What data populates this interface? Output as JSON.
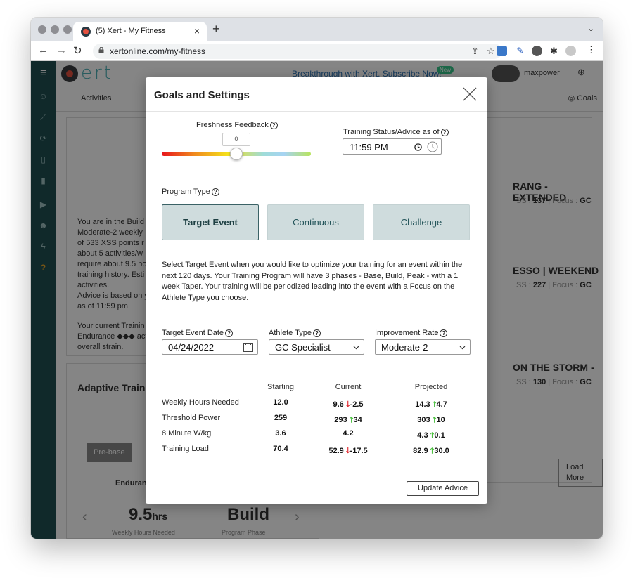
{
  "browser": {
    "tab_title": "(5) Xert - My Fitness",
    "url": "xertonline.com/my-fitness"
  },
  "app": {
    "logo": "ert",
    "promo": "Breakthrough with Xert. Subscribe Now!",
    "new_badge": "New",
    "notif_count": "5",
    "username": "maxpower",
    "subnav_activities": "Activities",
    "subnav_goals": "Goals"
  },
  "background": {
    "status_lines": [
      "You are in the Build",
      "Moderate-2 weekly",
      "of 533 XSS points r",
      "about 5 activities/w",
      "require about 9.5 ho",
      "training history. Esti",
      "activities.",
      "Advice is based on y",
      "as of 11:59 pm"
    ],
    "current_lines": [
      "Your current Trainin",
      "Endurance ◆◆◆ act",
      "overall strain."
    ],
    "adaptive_title": "Adaptive Traini",
    "pre_base": "Pre-base",
    "endurance": "Enduran",
    "hours_value": "9.5",
    "hours_unit": "hrs",
    "hours_label": "Weekly Hours Needed",
    "phase_value": "Build",
    "phase_label": "Program Phase",
    "workouts": [
      {
        "title": "RANG - EXTENDED",
        "meta_pre": "SS : ",
        "xss": "137",
        "meta_mid": " | Focus : ",
        "focus": "GC"
      },
      {
        "title": "ESSO | WEEKEND",
        "meta_pre": "SS : ",
        "xss": "227",
        "meta_mid": " | Focus : ",
        "focus": "GC"
      },
      {
        "title": "ON THE STORM -",
        "meta_pre": "SS : ",
        "xss": "130",
        "meta_mid": " | Focus : ",
        "focus": "GC"
      }
    ],
    "load_more": "Load More"
  },
  "modal": {
    "title": "Goals and Settings",
    "freshness_label": "Freshness Feedback",
    "freshness_value": "0",
    "freshness_level": 0.5,
    "status_label": "Training Status/Advice as of",
    "status_time": "11:59 PM",
    "program_type_label": "Program Type",
    "program_types": [
      "Target Event",
      "Continuous",
      "Challenge"
    ],
    "program_selected": "Target Event",
    "description": "Select Target Event when you would like to optimize your training for an event within the next 120 days. Your Training Program will have 3 phases - Base, Build, Peak - with a 1 week Taper. Your training will be periodized leading into the event with a Focus on the Athlete Type you choose.",
    "target_date_label": "Target Event Date",
    "target_date": "04/24/2022",
    "athlete_type_label": "Athlete Type",
    "athlete_type": "GC Specialist",
    "improvement_label": "Improvement Rate",
    "improvement_rate": "Moderate-2",
    "table_headers": [
      "Starting",
      "Current",
      "Projected"
    ],
    "rows": [
      {
        "label": "Weekly Hours Needed",
        "starting": "12.0",
        "current": "9.6",
        "current_delta": "-2.5",
        "current_dir": "down",
        "projected": "14.3",
        "projected_delta": "4.7",
        "projected_dir": "up"
      },
      {
        "label": "Threshold Power",
        "starting": "259",
        "current": "293",
        "current_delta": "34",
        "current_dir": "up",
        "projected": "303",
        "projected_delta": "10",
        "projected_dir": "up"
      },
      {
        "label": "8 Minute W/kg",
        "starting": "3.6",
        "current": "4.2",
        "current_delta": "",
        "current_dir": "none",
        "projected": "4.3",
        "projected_delta": "0.1",
        "projected_dir": "up"
      },
      {
        "label": "Training Load",
        "starting": "70.4",
        "current": "52.9",
        "current_delta": "-17.5",
        "current_dir": "down",
        "projected": "82.9",
        "projected_delta": "30.0",
        "projected_dir": "up"
      }
    ],
    "update_button": "Update Advice"
  },
  "colors": {
    "sidebar": "#1f4f52",
    "accent": "#4fb0b6",
    "program_button": "#cfdcdd",
    "arrow_down": "#e0232a",
    "arrow_up": "#4bbf3f"
  }
}
